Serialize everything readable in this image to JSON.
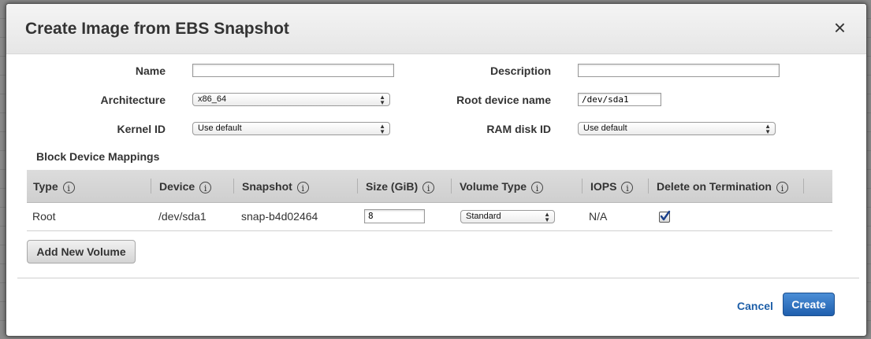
{
  "dialog": {
    "title": "Create Image from EBS Snapshot",
    "close_label": "×"
  },
  "form": {
    "name_label": "Name",
    "name_value": "",
    "description_label": "Description",
    "description_value": "",
    "architecture_label": "Architecture",
    "architecture_value": "x86_64",
    "root_device_label": "Root device name",
    "root_device_value": "/dev/sda1",
    "kernel_label": "Kernel ID",
    "kernel_value": "Use default",
    "ramdisk_label": "RAM disk ID",
    "ramdisk_value": "Use default"
  },
  "mappings": {
    "heading": "Block Device Mappings",
    "columns": [
      "Type",
      "Device",
      "Snapshot",
      "Size (GiB)",
      "Volume Type",
      "IOPS",
      "Delete on Termination"
    ],
    "info_glyph": "i",
    "rows": [
      {
        "type": "Root",
        "device": "/dev/sda1",
        "snapshot": "snap-b4d02464",
        "size": "8",
        "volume_type": "Standard",
        "iops": "N/A",
        "delete_on_termination": true
      }
    ],
    "add_button": "Add New Volume"
  },
  "footer": {
    "cancel_label": "Cancel",
    "create_label": "Create"
  },
  "colors": {
    "primary_button": "#1f5fae",
    "link": "#1e5fa8"
  },
  "icons": {
    "select_arrow": "select-arrows-icon",
    "info": "info-icon",
    "close": "close-icon",
    "check": "checkmark-icon"
  }
}
